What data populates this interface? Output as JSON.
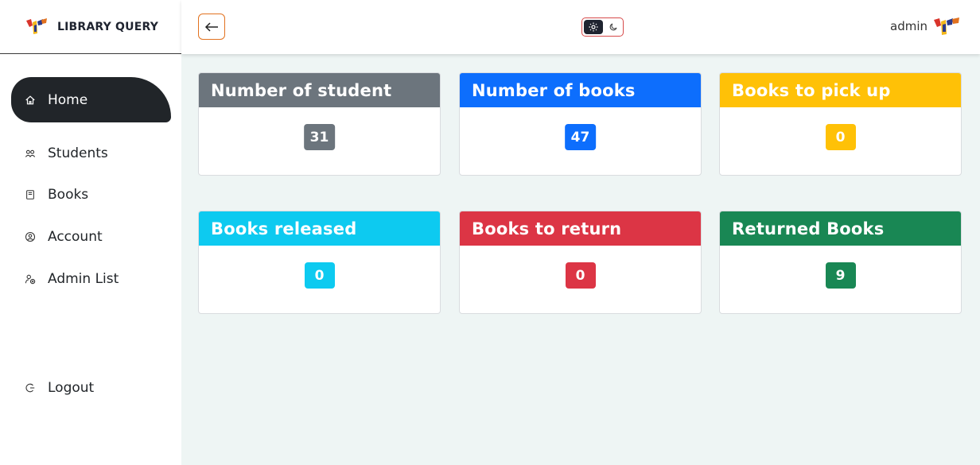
{
  "sidebar": {
    "brand": "LIBRARY QUERY",
    "items": [
      {
        "label": "Home",
        "icon": "home-icon"
      },
      {
        "label": "Students",
        "icon": "users-icon"
      },
      {
        "label": "Books",
        "icon": "book-icon"
      },
      {
        "label": "Account",
        "icon": "account-icon"
      },
      {
        "label": "Admin List",
        "icon": "admin-icon"
      },
      {
        "label": "Logout",
        "icon": "logout-icon"
      }
    ]
  },
  "header": {
    "username": "admin",
    "theme": {
      "light_icon": "sun-icon",
      "dark_icon": "moon-icon",
      "selected": "light"
    }
  },
  "colors": {
    "gray": "#6c757d",
    "blue": "#0d6efd",
    "yellow": "#ffc107",
    "cyan": "#0dcaf0",
    "red": "#dc3545",
    "green": "#198754",
    "sidebar_active": "#212529",
    "background": "#eef5f4"
  },
  "cards": [
    {
      "title": "Number of student",
      "value": "31"
    },
    {
      "title": "Number of books",
      "value": "47"
    },
    {
      "title": "Books to pick up",
      "value": "0"
    },
    {
      "title": "Books released",
      "value": "0"
    },
    {
      "title": "Books to return",
      "value": "0"
    },
    {
      "title": "Returned Books",
      "value": "9"
    }
  ]
}
